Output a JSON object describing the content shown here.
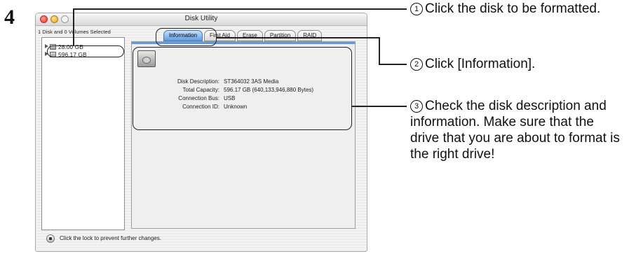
{
  "step_number": "4",
  "window": {
    "title": "Disk Utility",
    "summary": "1 Disk and 0 Volumes Selected"
  },
  "sidebar": {
    "items": [
      {
        "label": "28.00 GB"
      },
      {
        "label": "596.17 GB"
      }
    ]
  },
  "tabs": [
    {
      "label": "Information",
      "active": true
    },
    {
      "label": "First Aid"
    },
    {
      "label": "Erase"
    },
    {
      "label": "Partition"
    },
    {
      "label": "RAID"
    }
  ],
  "info": {
    "rows": [
      {
        "label": "Disk Description:",
        "value": "ST364032 3AS Media"
      },
      {
        "label": "Total Capacity:",
        "value": "596.17 GB (640,133,946,880 Bytes)"
      },
      {
        "label": "Connection Bus:",
        "value": "USB"
      },
      {
        "label": "Connection ID:",
        "value": "Unknown"
      }
    ]
  },
  "lock_text": "Click the lock to prevent further changes.",
  "annotations": [
    {
      "num": "1",
      "text": "Click the disk to be formatted."
    },
    {
      "num": "2",
      "text": "Click [Information]."
    },
    {
      "num": "3",
      "text": "Check the disk description and information.  Make sure that the drive that you are about to format is the right drive!"
    }
  ],
  "colors": {
    "accent": "#5f9be0",
    "active_tab": "#5b9be4",
    "close_button": "#e0382a",
    "minimize_button": "#e4a320"
  }
}
